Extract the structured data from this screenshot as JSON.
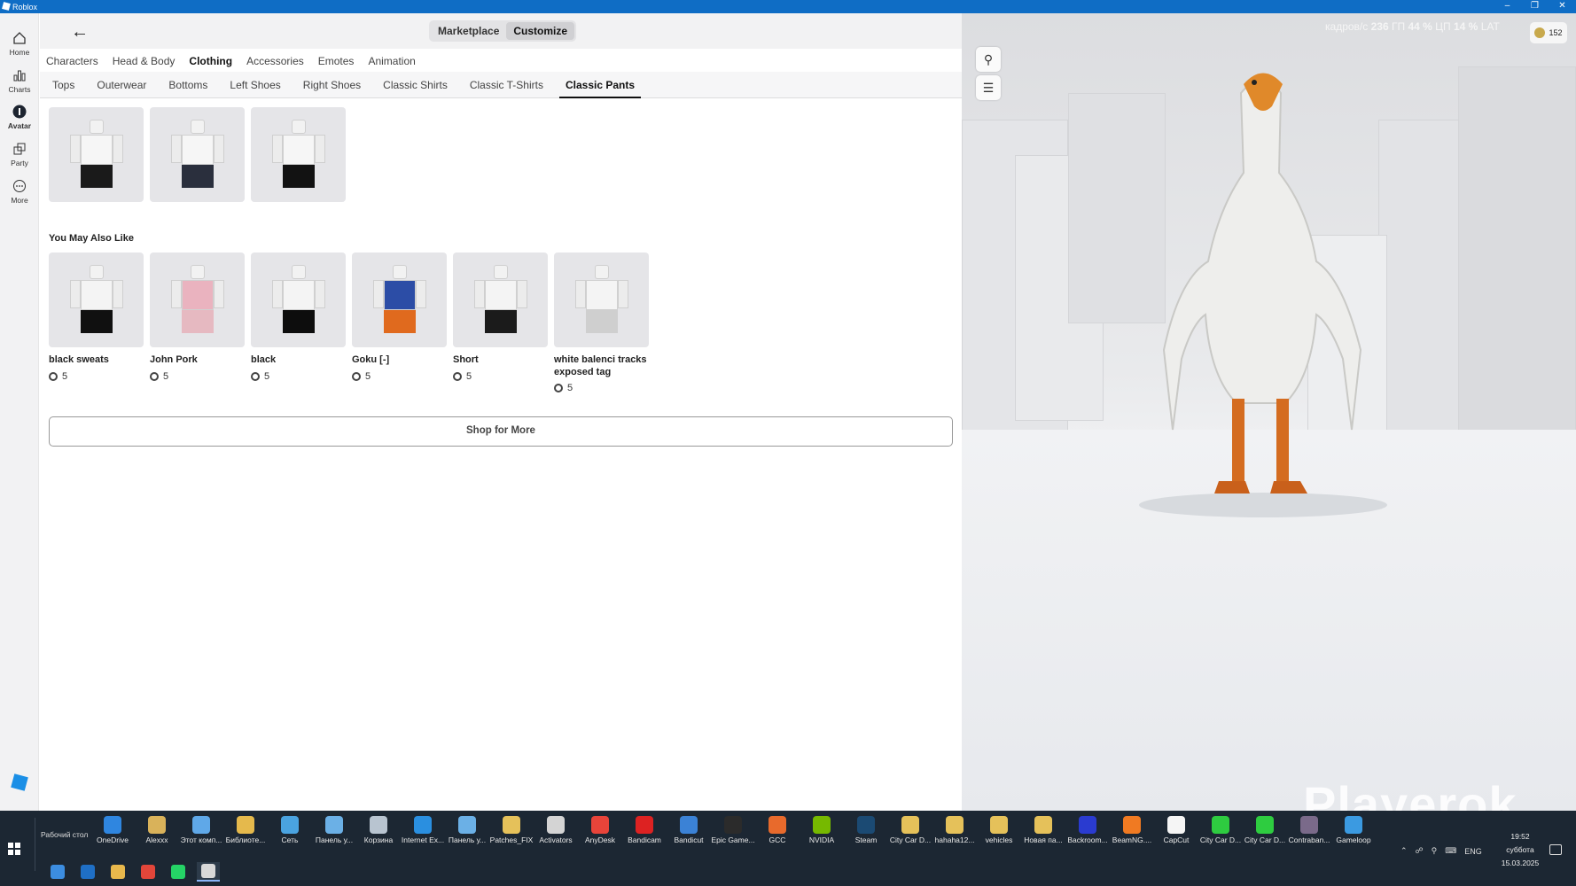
{
  "window": {
    "title": "Roblox"
  },
  "leftnav": {
    "items": [
      {
        "label": "Home",
        "icon": "home-icon"
      },
      {
        "label": "Charts",
        "icon": "charts-icon"
      },
      {
        "label": "Avatar",
        "icon": "avatar-icon",
        "active": true
      },
      {
        "label": "Party",
        "icon": "party-icon"
      },
      {
        "label": "More",
        "icon": "more-icon"
      }
    ]
  },
  "topbar": {
    "segments": [
      "Marketplace",
      "Customize"
    ],
    "active_segment": "Customize"
  },
  "categories": [
    "Characters",
    "Head & Body",
    "Clothing",
    "Accessories",
    "Emotes",
    "Animation"
  ],
  "active_category": "Clothing",
  "subcategories": [
    "Tops",
    "Outerwear",
    "Bottoms",
    "Left Shoes",
    "Right Shoes",
    "Classic Shirts",
    "Classic T-Shirts",
    "Classic Pants"
  ],
  "active_subcategory": "Classic Pants",
  "owned_items": [
    {
      "pants_color": "#1a1a1a"
    },
    {
      "pants_color": "#2a2f3d"
    },
    {
      "pants_color": "#121212"
    }
  ],
  "recommendations": {
    "title": "You May Also Like",
    "items": [
      {
        "name": "black sweats",
        "price": "5",
        "pants_color": "#101010",
        "torso_color": "#f4f4f4"
      },
      {
        "name": "John Pork",
        "price": "5",
        "pants_color": "#e6b9c1",
        "torso_color": "#eab3bf"
      },
      {
        "name": "black",
        "price": "5",
        "pants_color": "#0d0d0d",
        "torso_color": "#f4f4f4"
      },
      {
        "name": "Goku [-]",
        "price": "5",
        "pants_color": "#e06a1e",
        "torso_color": "#2c4da6"
      },
      {
        "name": "Short",
        "price": "5",
        "pants_color": "#1b1b1b",
        "torso_color": "#f4f4f4"
      },
      {
        "name": "white balenci tracks exposed tag",
        "price": "5",
        "pants_color": "#cfcfcf",
        "torso_color": "#f4f4f4"
      }
    ]
  },
  "shop_button": "Shop for More",
  "viewport": {
    "stats_fps_label": "кадров/с",
    "stats_fps": "236",
    "stats_gpu_label": "ГП",
    "stats_gpu": "44 %",
    "stats_cpu_label": "ЦП",
    "stats_cpu": "14 %",
    "stats_lat_label": "LAT",
    "robux_balance": "152"
  },
  "watermark": "Playerok",
  "taskbar": {
    "desktop_label": "Рабочий стол",
    "shortcuts": [
      {
        "label": "OneDrive",
        "color": "#2f86e0"
      },
      {
        "label": "Alexxx",
        "color": "#d9b25a"
      },
      {
        "label": "Этот комп...",
        "color": "#5fa8e8"
      },
      {
        "label": "Библиоте...",
        "color": "#e5b94c"
      },
      {
        "label": "Сеть",
        "color": "#4aa3e0"
      },
      {
        "label": "Панель у...",
        "color": "#6bb0e6"
      },
      {
        "label": "Корзина",
        "color": "#b8c4d0"
      },
      {
        "label": "Internet Ex...",
        "color": "#2a8fe0"
      },
      {
        "label": "Панель у...",
        "color": "#6bb0e6"
      },
      {
        "label": "Patches_FIX",
        "color": "#e5c15a"
      },
      {
        "label": "Activators",
        "color": "#d4d4d4"
      },
      {
        "label": "AnyDesk",
        "color": "#e8443a"
      },
      {
        "label": "Bandicam",
        "color": "#dd2222"
      },
      {
        "label": "Bandicut",
        "color": "#3b82d6"
      },
      {
        "label": "Epic Game...",
        "color": "#2b2b2b"
      },
      {
        "label": "GCC",
        "color": "#e86a2c"
      },
      {
        "label": "NVIDIA",
        "color": "#76b900"
      },
      {
        "label": "Steam",
        "color": "#1b4a73"
      },
      {
        "label": "City Car D...",
        "color": "#e5c15a"
      },
      {
        "label": "hahaha12...",
        "color": "#e5c15a"
      },
      {
        "label": "vehicles",
        "color": "#e5c15a"
      },
      {
        "label": "Новая па...",
        "color": "#e5c15a"
      },
      {
        "label": "Backroom...",
        "color": "#2a3bd0"
      },
      {
        "label": "BeamNG....",
        "color": "#f07a22"
      },
      {
        "label": "CapCut",
        "color": "#f5f5f5"
      },
      {
        "label": "City Car D...",
        "color": "#2ecc40"
      },
      {
        "label": "City Car D...",
        "color": "#2ecc40"
      },
      {
        "label": "Contraban...",
        "color": "#7a6a8a"
      },
      {
        "label": "Gameloop",
        "color": "#3b9ae1"
      }
    ],
    "pinned": [
      {
        "name": "store-icon",
        "color": "#3c8de0"
      },
      {
        "name": "outlook-icon",
        "color": "#1f6fc5"
      },
      {
        "name": "explorer-icon",
        "color": "#e8b84c"
      },
      {
        "name": "chrome-icon",
        "color": "#e2463a"
      },
      {
        "name": "whatsapp-icon",
        "color": "#25d366"
      },
      {
        "name": "roblox-icon",
        "color": "#d8d8d8"
      }
    ],
    "tray_lang": "ENG",
    "time": "19:52",
    "day": "суббота",
    "date": "15.03.2025"
  }
}
